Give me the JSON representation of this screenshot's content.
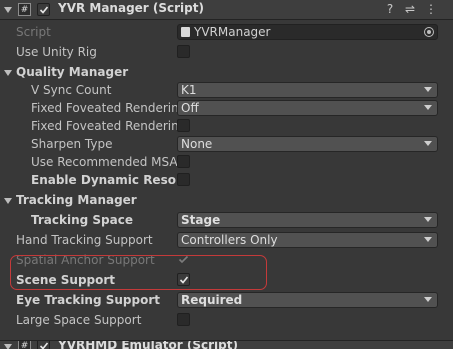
{
  "component": {
    "title": "YVR Manager (Script)",
    "enabled": true,
    "icons": [
      "help-icon",
      "preset-icon",
      "more-icon"
    ]
  },
  "fields": {
    "script_label": "Script",
    "script_value": "YVRManager",
    "use_unity_rig_label": "Use Unity Rig",
    "use_unity_rig_checked": false
  },
  "quality_manager": {
    "header": "Quality Manager",
    "v_sync_count_label": "V Sync Count",
    "v_sync_count_value": "K1",
    "fixed_foveated_level_label": "Fixed Foveated Rendering",
    "fixed_foveated_level_value": "Off",
    "fixed_foveated_dynamic_label": "Fixed Foveated Rendering",
    "fixed_foveated_dynamic_checked": false,
    "sharpen_type_label": "Sharpen Type",
    "sharpen_type_value": "None",
    "use_recommended_msaa_label": "Use Recommended MSAA",
    "use_recommended_msaa_checked": false,
    "enable_dynamic_resolution_label": "Enable Dynamic Resolution",
    "enable_dynamic_resolution_checked": false
  },
  "tracking_manager": {
    "header": "Tracking Manager",
    "tracking_space_label": "Tracking Space",
    "tracking_space_value": "Stage",
    "hand_tracking_support_label": "Hand Tracking Support",
    "hand_tracking_support_value": "Controllers Only",
    "spatial_anchor_support_label": "Spatial Anchor Support",
    "spatial_anchor_support_checked": true,
    "scene_support_label": "Scene Support",
    "scene_support_checked": true,
    "eye_tracking_support_label": "Eye Tracking Support",
    "eye_tracking_support_value": "Required",
    "large_space_support_label": "Large Space Support",
    "large_space_support_checked": false
  },
  "next_component": {
    "title": "YVRHMD Emulator (Script)"
  },
  "colors": {
    "background": "#383838",
    "highlight_border": "#c43a3a",
    "dropdown_bg": "#515151"
  }
}
